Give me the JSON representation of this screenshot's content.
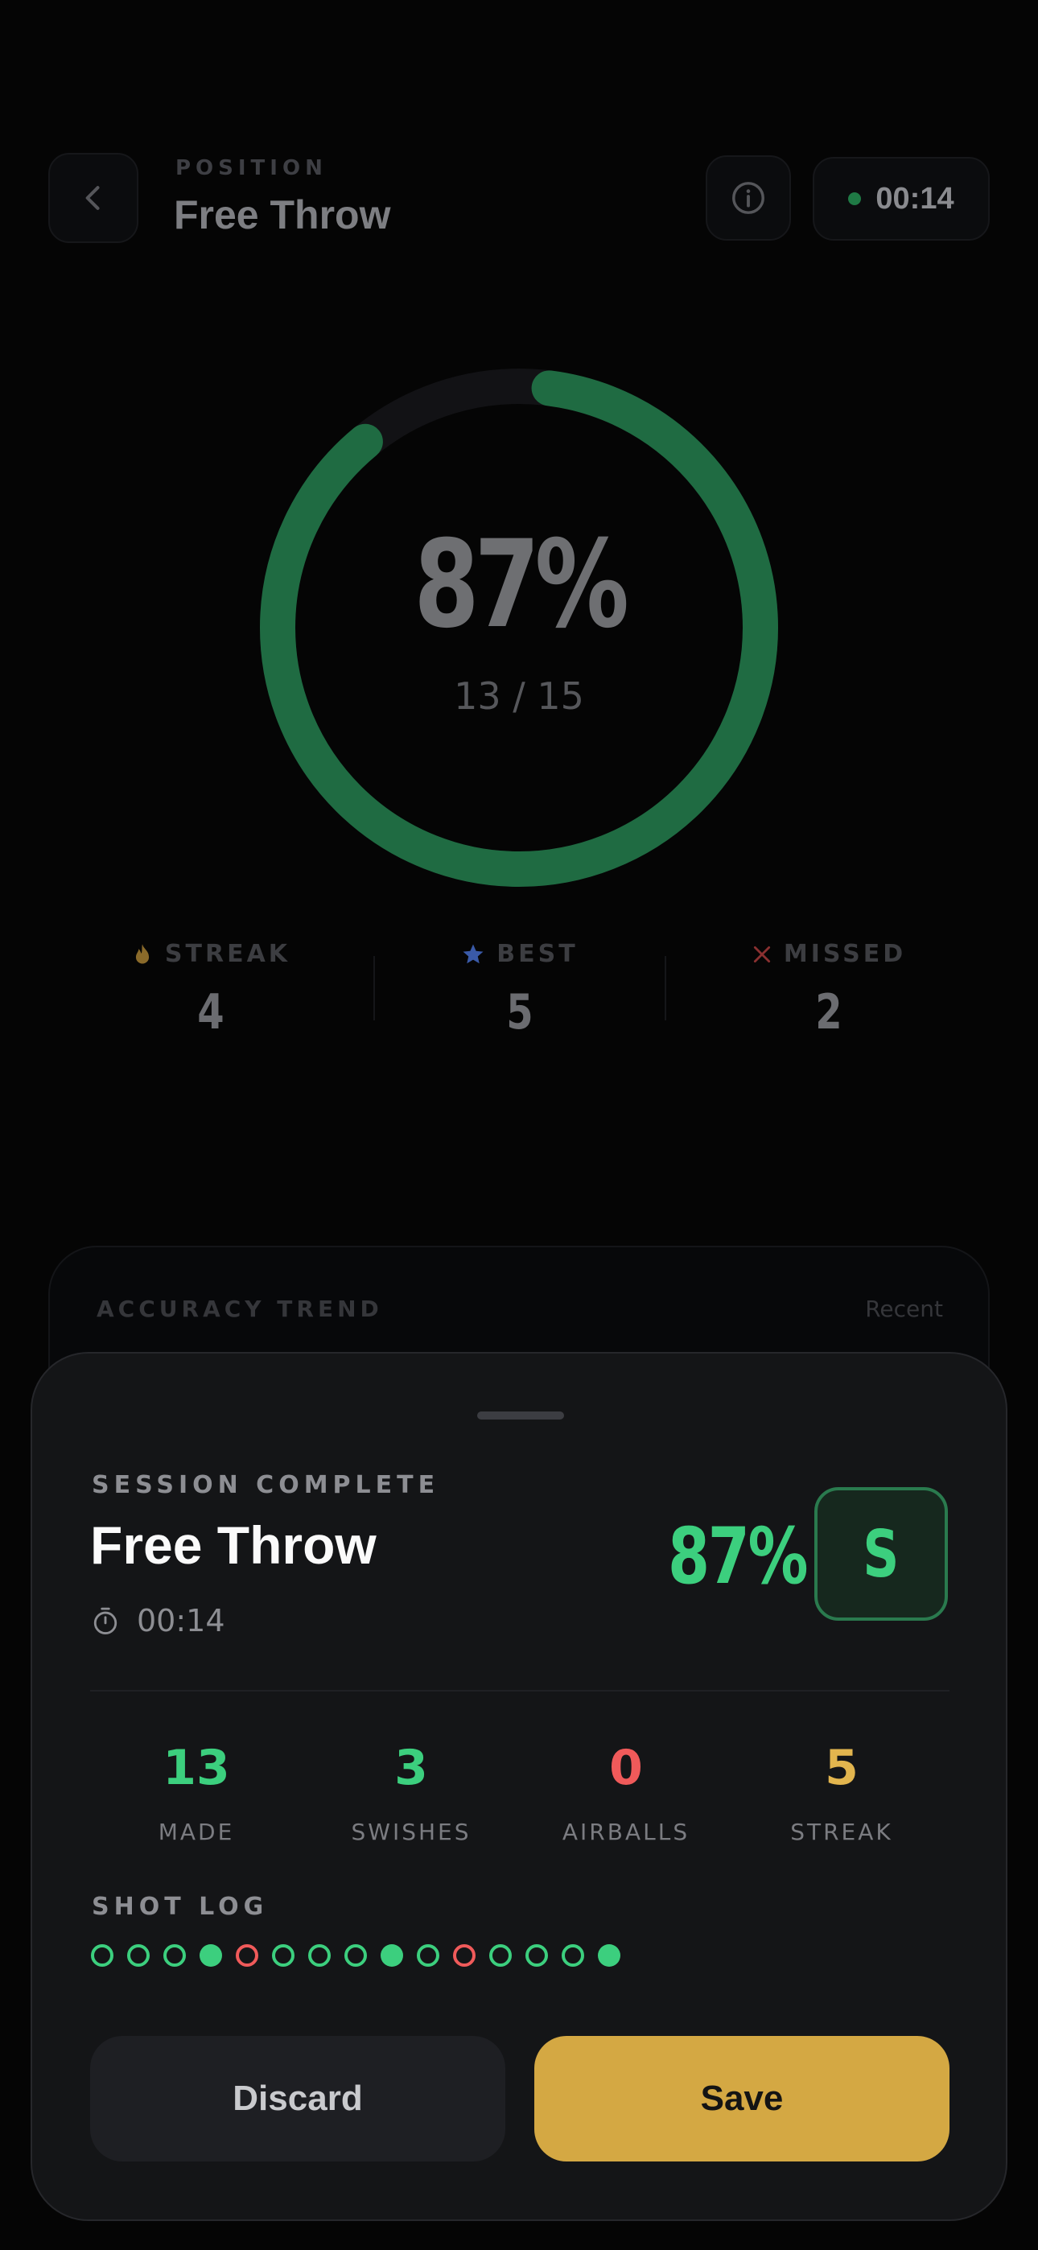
{
  "header": {
    "position_label": "POSITION",
    "position_title": "Free Throw",
    "timer": "00:14"
  },
  "progress": {
    "percent_text": "87%",
    "count_text": "13 / 15",
    "fraction": 0.87
  },
  "stats": [
    {
      "label": "STREAK",
      "value": "4",
      "icon": "flame-icon",
      "color": "#8a6a2a"
    },
    {
      "label": "BEST",
      "value": "5",
      "icon": "star-icon",
      "color": "#3a5aa8"
    },
    {
      "label": "MISSED",
      "value": "2",
      "icon": "x-icon",
      "color": "#8a3030"
    }
  ],
  "trend": {
    "label": "ACCURACY TREND",
    "recent": "Recent"
  },
  "sheet": {
    "label": "SESSION COMPLETE",
    "title": "Free Throw",
    "time": "00:14",
    "percent": "87%",
    "grade": "S",
    "metrics": [
      {
        "value": "13",
        "label": "MADE",
        "color": "#3ccf7e"
      },
      {
        "value": "3",
        "label": "SWISHES",
        "color": "#3ccf7e"
      },
      {
        "value": "0",
        "label": "AIRBALLS",
        "color": "#f05a5a"
      },
      {
        "value": "5",
        "label": "STREAK",
        "color": "#e2b54e"
      }
    ],
    "shot_log_label": "SHOT LOG",
    "shot_log": [
      "made",
      "made",
      "made",
      "swish",
      "miss",
      "made",
      "made",
      "made",
      "swish",
      "made",
      "miss",
      "made",
      "made",
      "made",
      "swish"
    ],
    "discard_label": "Discard",
    "save_label": "Save"
  },
  "colors": {
    "accent_green": "#3ccf7e",
    "accent_gold": "#d4a843",
    "miss_red": "#f05a5a"
  }
}
